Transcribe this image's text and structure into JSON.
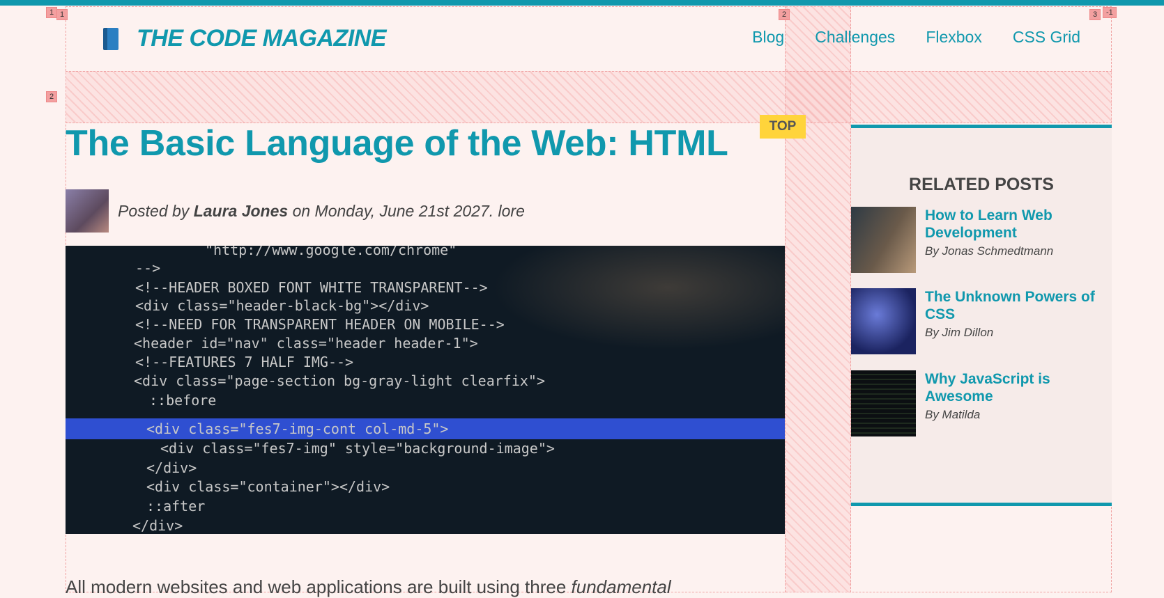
{
  "header": {
    "brand": "THE CODE MAGAZINE",
    "brand_icon": "blue-book-icon",
    "nav": [
      {
        "label": "Blog"
      },
      {
        "label": "Challenges"
      },
      {
        "label": "Flexbox"
      },
      {
        "label": "CSS Grid"
      }
    ]
  },
  "grid_overlay": {
    "badges": [
      "1",
      "1",
      "2",
      "3",
      "-1",
      "2"
    ]
  },
  "article": {
    "title": "The Basic Language of the Web: HTML",
    "top_badge": "TOP",
    "meta": {
      "prefix": "Posted by ",
      "author": "Laura Jones",
      "suffix": " on Monday, June 21st 2027. lore"
    },
    "hero_code": [
      "\"http://www.google.com/chrome\"",
      "-->",
      "<!--HEADER BOXED FONT WHITE TRANSPARENT-->",
      "<div class=\"header-black-bg\"></div>",
      "<!--NEED FOR TRANSPARENT HEADER ON MOBILE-->",
      "<header id=\"nav\" class=\"header header-1\">",
      "<!--FEATURES 7 HALF IMG-->",
      "<div class=\"page-section bg-gray-light clearfix\">",
      "::before",
      "<div class=\"fes7-img-cont col-md-5\">",
      "<div class=\"fes7-img\" style=\"background-image\">",
      "</div>",
      "<div class=\"container\"></div>",
      "::after",
      "</div>"
    ],
    "intro_start": "All modern websites and web applications are built using three ",
    "intro_em": "fundamental"
  },
  "sidebar": {
    "title": "RELATED POSTS",
    "posts": [
      {
        "title": "How to Learn Web Development",
        "author": "By Jonas Schmedtmann"
      },
      {
        "title": "The Unknown Powers of CSS",
        "author": "By Jim Dillon"
      },
      {
        "title": "Why JavaScript is Awesome",
        "author": "By Matilda"
      }
    ]
  },
  "colors": {
    "accent": "#1098ad",
    "top_bar": "#1098ad",
    "badge": "#ffd43b",
    "page_bg": "#fdf2f0"
  }
}
